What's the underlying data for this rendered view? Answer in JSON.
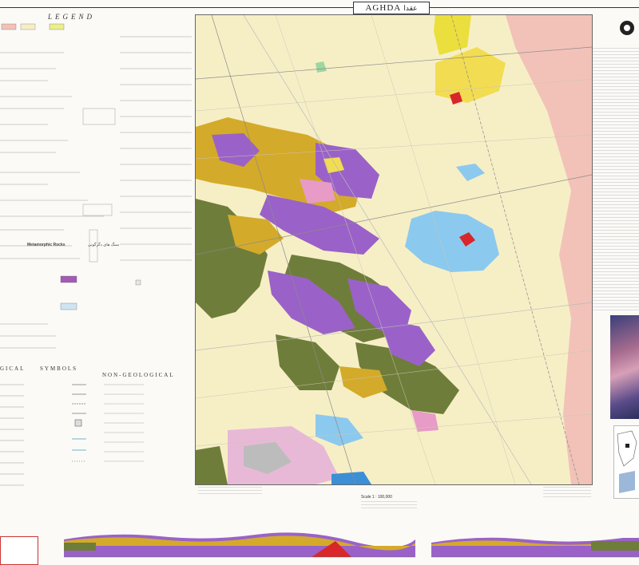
{
  "map": {
    "title": "AGHDA",
    "title_fa": "عقدا",
    "legend_label": "LEGEND",
    "metamorphic_heading": "Metamorphic Rocks",
    "metamorphic_heading_fa": "سنگ های دگرگونی",
    "symbols_geological": "GICAL",
    "symbols_label": "SYMBOLS",
    "symbols_nongeological": "NON-GEOLOGICAL",
    "scale": "Scale 1 : 100,000",
    "colors": {
      "alluvium": "#f6efc6",
      "purple_unit": "#9a62c8",
      "olive_unit": "#6f7d3a",
      "ochre_unit": "#d4aa2a",
      "yellow_unit": "#f2dc52",
      "salmon_unit": "#f2c2b8",
      "pink_unit": "#e79bc6",
      "blue_unit": "#8cc9ee",
      "red_unit": "#d8262a",
      "grey_unit": "#bcbcbc"
    },
    "icons": [
      "institute-logo-icon",
      "north-arrow-icon"
    ]
  }
}
